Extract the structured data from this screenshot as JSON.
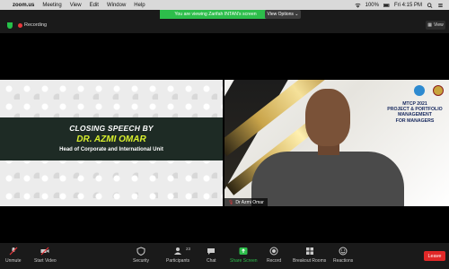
{
  "menubar": {
    "app_name": "zoom.us",
    "items": [
      "Meeting",
      "View",
      "Edit",
      "Window",
      "Help"
    ],
    "battery": "100%",
    "clock": "Fri 4:15 PM"
  },
  "share_banner": {
    "text": "You are viewing Zarifah INTAN's screen",
    "view_options": "View Options"
  },
  "top": {
    "recording_label": "Recording",
    "view_label": "View"
  },
  "slide": {
    "title": "CLOSING SPEECH BY",
    "speaker": "DR. AZMI OMAR",
    "role": "Head of Corporate and International Unit"
  },
  "video": {
    "program": [
      "MTCP 2021",
      "PROJECT & PORTFOLIO",
      "MANAGEMENT",
      "FOR MANAGERS"
    ],
    "participant_name": "Dr Azmi Omar"
  },
  "toolbar": {
    "unmute": "Unmute",
    "start_video": "Start Video",
    "security": "Security",
    "participants": "Participants",
    "participants_count": "23",
    "chat": "Chat",
    "share_screen": "Share Screen",
    "record": "Record",
    "breakout_rooms": "Breakout Rooms",
    "reactions": "Reactions",
    "leave": "Leave"
  },
  "colors": {
    "share_green": "#2dbe4b",
    "leave_red": "#e02828",
    "speaker_yellow": "#d9f02e"
  }
}
